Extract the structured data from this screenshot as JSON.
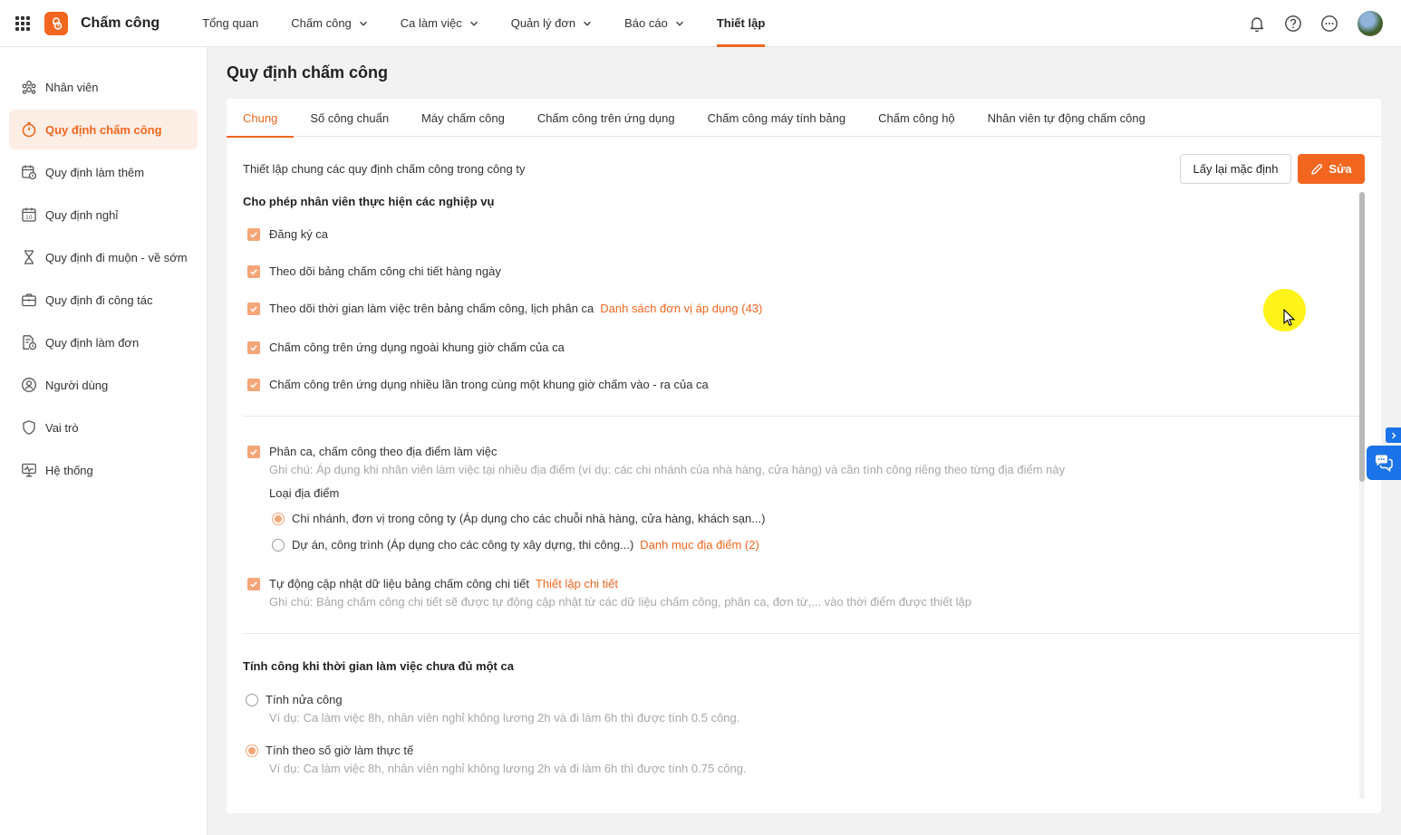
{
  "app": {
    "name": "Chấm công"
  },
  "topnav": {
    "items": [
      {
        "label": "Tổng quan",
        "dropdown": false,
        "active": false
      },
      {
        "label": "Chấm công",
        "dropdown": true,
        "active": false
      },
      {
        "label": "Ca làm việc",
        "dropdown": true,
        "active": false
      },
      {
        "label": "Quản lý đơn",
        "dropdown": true,
        "active": false
      },
      {
        "label": "Báo cáo",
        "dropdown": true,
        "active": false
      },
      {
        "label": "Thiết lập",
        "dropdown": false,
        "active": true
      }
    ],
    "icons": [
      "bell-icon",
      "help-icon",
      "more-icon",
      "avatar"
    ]
  },
  "sidebar": {
    "items": [
      {
        "label": "Nhân viên",
        "icon": "users-icon",
        "active": false
      },
      {
        "label": "Quy định chấm công",
        "icon": "timer-icon",
        "active": true
      },
      {
        "label": "Quy định làm thêm",
        "icon": "calendar-clock-icon",
        "active": false
      },
      {
        "label": "Quy định nghỉ",
        "icon": "calendar-icon",
        "active": false
      },
      {
        "label": "Quy định đi muộn - về sớm",
        "icon": "hourglass-icon",
        "active": false
      },
      {
        "label": "Quy định đi công tác",
        "icon": "briefcase-icon",
        "active": false
      },
      {
        "label": "Quy định làm đơn",
        "icon": "document-clock-icon",
        "active": false
      },
      {
        "label": "Người dùng",
        "icon": "user-circle-icon",
        "active": false
      },
      {
        "label": "Vai trò",
        "icon": "shield-icon",
        "active": false
      },
      {
        "label": "Hệ thống",
        "icon": "monitor-icon",
        "active": false
      }
    ]
  },
  "page": {
    "title": "Quy định chấm công"
  },
  "tabs": [
    {
      "label": "Chung",
      "active": true
    },
    {
      "label": "Số công chuẩn",
      "active": false
    },
    {
      "label": "Máy chấm công",
      "active": false
    },
    {
      "label": "Chấm công trên ứng dụng",
      "active": false
    },
    {
      "label": "Chấm công máy tính bảng",
      "active": false
    },
    {
      "label": "Chấm công hộ",
      "active": false
    },
    {
      "label": "Nhân viên tự động chấm công",
      "active": false
    }
  ],
  "general": {
    "description": "Thiết lập chung các quy định chấm công trong công ty",
    "reset_label": "Lấy lại mặc định",
    "edit_label": "Sửa",
    "section1_title": "Cho phép nhân viên thực hiện các nghiệp vụ",
    "opt1": "Đăng ký ca",
    "opt2": "Theo dõi bảng chấm công chi tiết hàng ngày",
    "opt3": "Theo dõi thời gian làm việc trên bảng chấm công, lịch phân ca",
    "opt3_link": "Danh sách đơn vị áp dụng (43)",
    "opt4": "Chấm công trên ứng dụng ngoài khung giờ chấm của ca",
    "opt5": "Chấm công trên ứng dụng nhiều lần trong cùng một khung giờ chấm vào - ra của ca",
    "opt6": "Phân ca, chấm công theo địa điểm làm việc",
    "opt6_note": "Ghi chú: Áp dụng khi nhân viên làm việc tại nhiều địa điểm (ví dụ: các chi nhánh của nhà hàng, cửa hàng) và cần tính công riêng theo từng địa điểm này",
    "location_type_label": "Loại địa điểm",
    "loc_radio1": "Chi nhánh, đơn vị trong công ty (Áp dụng cho các chuỗi nhà hàng, cửa hàng, khách sạn...)",
    "loc_radio2": "Dự án, công trình (Áp dụng cho các công ty xây dựng, thi công...)",
    "loc_radio2_link": "Danh mục địa điểm (2)",
    "loc_selected": 1,
    "opt7": "Tự động cập nhật dữ liệu bảng chấm công chi tiết",
    "opt7_link": "Thiết lập chi tiết",
    "opt7_note": "Ghi chú: Bảng chấm công chi tiết sẽ được tự động cập nhật từ các dữ liệu chấm công, phân ca, đơn từ,... vào thời điểm được thiết lập",
    "section2_title": "Tính công khi thời gian làm việc chưa đủ một ca",
    "calc_radio1": "Tính nửa công",
    "calc_radio1_note": "Ví dụ: Ca làm việc 8h, nhân viên nghỉ không lương 2h và đi làm 6h thì được tính 0.5 công.",
    "calc_radio2": "Tính theo số giờ làm thực tế",
    "calc_radio2_note": "Ví dụ: Ca làm việc 8h, nhân viên nghỉ không lương 2h và đi làm 6h thì được tính 0.75 công.",
    "calc_selected": 2
  },
  "colors": {
    "accent": "#f2661f",
    "checkbox": "#f5a679",
    "accent_bg": "#fdeee5",
    "chat": "#1a73e8"
  }
}
